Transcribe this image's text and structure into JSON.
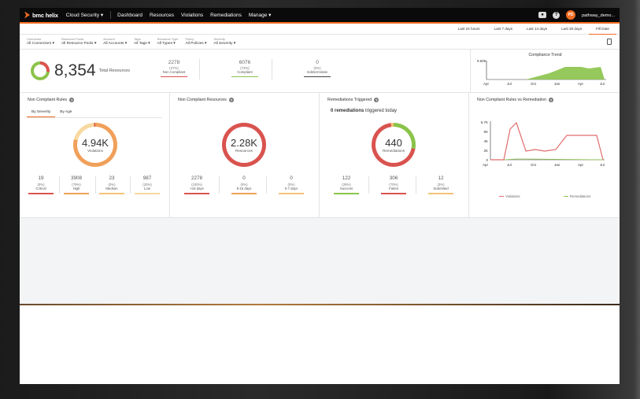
{
  "nav": {
    "brand": "bmc helix",
    "items": [
      "Cloud Security",
      "Dashboard",
      "Resources",
      "Violations",
      "Remediations",
      "Manage"
    ],
    "user_initials": "PD",
    "user_name": "pathway_demo..."
  },
  "date_range": {
    "options": [
      "Last 24 hours",
      "Last 7 days",
      "Last 14 days",
      "Last 30 days",
      "Fill Date"
    ],
    "active": "Fill Date"
  },
  "filters": [
    {
      "label": "Connector",
      "value": "All Connectors"
    },
    {
      "label": "Resource Pools",
      "value": "All Resource Pools"
    },
    {
      "label": "Account",
      "value": "All Accounts"
    },
    {
      "label": "Tags",
      "value": "All Tags"
    },
    {
      "label": "Resource Type",
      "value": "All Types"
    },
    {
      "label": "Policy",
      "value": "All Policies"
    },
    {
      "label": "Severity",
      "value": "All Severity"
    }
  ],
  "summary": {
    "total": "8,354",
    "total_label": "Total Resources",
    "metrics": [
      {
        "value": "2278",
        "pct": "(27%)",
        "label": "Non Compliant",
        "color": "#d9534f"
      },
      {
        "value": "6076",
        "pct": "(73%)",
        "label": "Compliant",
        "color": "#8bc34a"
      },
      {
        "value": "0",
        "pct": "(0%)",
        "label": "Indeterminate",
        "color": "#444444"
      }
    ],
    "compliance_trend": {
      "title": "Compliance Trend",
      "y_tick": "9.60K",
      "x_ticks": [
        "Apr",
        "Jul",
        "Oct",
        "Jan",
        "Apr",
        "Jul"
      ]
    }
  },
  "panels": {
    "rules": {
      "title": "Non Compliant Rules",
      "tabs": [
        "By Severity",
        "By Age"
      ],
      "active_tab": "By Severity",
      "value": "4.94K",
      "label": "Violations",
      "stats": [
        {
          "value": "19",
          "pct": "(0%)",
          "label": "Critical",
          "color": "#d9534f"
        },
        {
          "value": "3908",
          "pct": "(79%)",
          "label": "High",
          "color": "#f0a05a"
        },
        {
          "value": "23",
          "pct": "(0%)",
          "label": "Medium",
          "color": "#f5c27a"
        },
        {
          "value": "987",
          "pct": "(20%)",
          "label": "Low",
          "color": "#f7d9a0"
        }
      ]
    },
    "resources": {
      "title": "Non Compliant Resources",
      "value": "2.28K",
      "label": "Resources",
      "stats": [
        {
          "value": "2278",
          "pct": "(100%)",
          "label": ">15 days",
          "color": "#d9534f"
        },
        {
          "value": "0",
          "pct": "(0%)",
          "label": "8-15 days",
          "color": "#f0a05a"
        },
        {
          "value": "0",
          "pct": "(0%)",
          "label": "0-7 days",
          "color": "#f5c27a"
        }
      ]
    },
    "remediations": {
      "title": "Remediations Triggered",
      "sub_count": "0 remediations",
      "sub_text": "triggered today",
      "value": "440",
      "label": "Remediations",
      "stats": [
        {
          "value": "122",
          "pct": "(28%)",
          "label": "Success",
          "color": "#8bc34a"
        },
        {
          "value": "306",
          "pct": "(70%)",
          "label": "Failed",
          "color": "#d9534f"
        },
        {
          "value": "12",
          "pct": "(3%)",
          "label": "Submitted",
          "color": "#f5c27a"
        }
      ]
    },
    "vs_chart": {
      "title": "Non Compliant Rules vs Remediation",
      "y_ticks": [
        "6.7K",
        "6K",
        "4K",
        "2K",
        "0"
      ],
      "x_ticks": [
        "Apr",
        "Jul",
        "Oct",
        "Jan",
        "Apr",
        "Jul"
      ],
      "legend": [
        {
          "name": "Violations",
          "color": "#e06b6b"
        },
        {
          "name": "Remediations",
          "color": "#8bc34a"
        }
      ]
    }
  }
}
